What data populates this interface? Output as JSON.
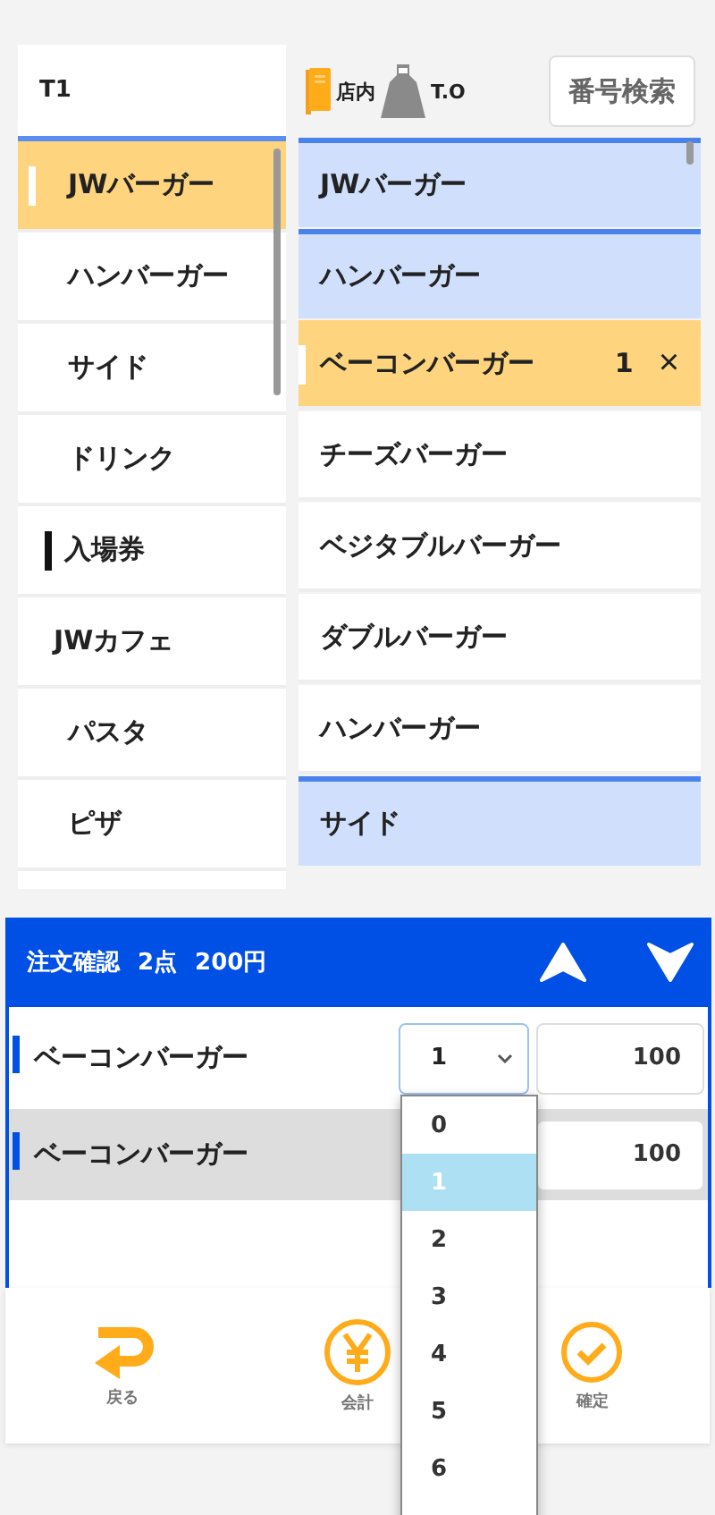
{
  "categories": {
    "header": "T1",
    "items": [
      {
        "label": "JWバーガー",
        "kind": "category",
        "selected": true
      },
      {
        "label": "ハンバーガー",
        "kind": "category",
        "selected": false
      },
      {
        "label": "サイド",
        "kind": "category",
        "selected": false
      },
      {
        "label": "ドリンク",
        "kind": "category",
        "selected": false
      },
      {
        "label": "入場券",
        "kind": "section",
        "selected": false
      },
      {
        "label": "JWカフェ",
        "kind": "plain",
        "selected": false
      },
      {
        "label": "パスタ",
        "kind": "category",
        "selected": false
      },
      {
        "label": "ピザ",
        "kind": "category",
        "selected": false
      }
    ]
  },
  "toolbar": {
    "eat_in": "店内",
    "take_out": "T.O",
    "search_button": "番号検索"
  },
  "products": [
    {
      "label": "JWバーガー",
      "kind": "group",
      "selected": false
    },
    {
      "label": "ハンバーガー",
      "kind": "group",
      "selected": false
    },
    {
      "label": "ベーコンバーガー",
      "kind": "product",
      "selected": true,
      "quantity": "1",
      "remove": "×"
    },
    {
      "label": "チーズバーガー",
      "kind": "product",
      "selected": false
    },
    {
      "label": "ベジタブルバーガー",
      "kind": "product",
      "selected": false
    },
    {
      "label": "ダブルバーガー",
      "kind": "product",
      "selected": false
    },
    {
      "label": "ハンバーガー",
      "kind": "product",
      "selected": false
    },
    {
      "label": "サイド",
      "kind": "group",
      "selected": false
    }
  ],
  "order": {
    "title": "注文確認",
    "count": "2点",
    "total": "200円",
    "rows": [
      {
        "name": "ベーコンバーガー",
        "quantity": "1",
        "price": "100",
        "selected": false
      },
      {
        "name": "ベーコンバーガー",
        "price": "100",
        "selected": true
      }
    ],
    "dropdown": {
      "options": [
        {
          "label": "0",
          "selected": false
        },
        {
          "label": "1",
          "selected": true
        },
        {
          "label": "2",
          "selected": false
        },
        {
          "label": "3",
          "selected": false
        },
        {
          "label": "4",
          "selected": false
        },
        {
          "label": "5",
          "selected": false
        },
        {
          "label": "6",
          "selected": false
        }
      ]
    }
  },
  "footer": [
    {
      "label": "戻る",
      "kind": "back"
    },
    {
      "label": "会計",
      "kind": "checkout"
    },
    {
      "label": "確定",
      "kind": "confirm"
    }
  ]
}
